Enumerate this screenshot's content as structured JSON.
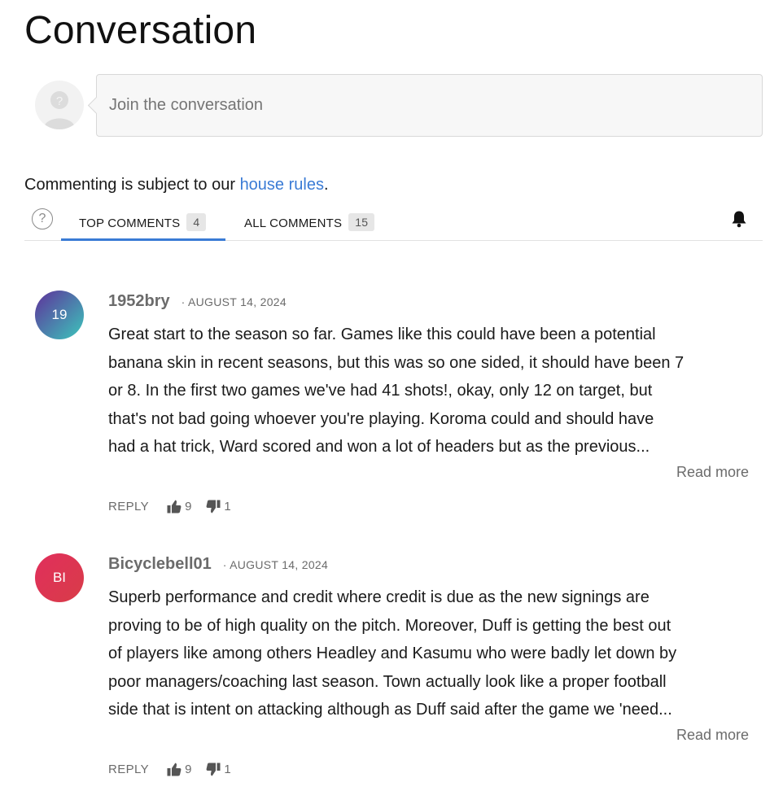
{
  "page": {
    "title": "Conversation"
  },
  "composer": {
    "placeholder": "Join the conversation"
  },
  "rules": {
    "prefix": "Commenting is subject to our ",
    "link": "house rules",
    "suffix": "."
  },
  "tabs": [
    {
      "label": "TOP COMMENTS",
      "count": "4",
      "active": true
    },
    {
      "label": "ALL COMMENTS",
      "count": "15",
      "active": false
    }
  ],
  "icons": {
    "help": "?",
    "bell": "bell-icon",
    "thumb_up": "thumbs-up-icon",
    "thumb_down": "thumbs-down-icon"
  },
  "colors": {
    "accent": "#3a7bd5",
    "avatar1_from": "#5b3f9e",
    "avatar1_to": "#3fb8b8",
    "avatar2_from": "#e0305a",
    "avatar2_to": "#d93b4a"
  },
  "comments": [
    {
      "avatar_text": "19",
      "username": "1952bry",
      "date": "· AUGUST 14, 2024",
      "lines": [
        "Great start to the season so far. Games like this could have been a potential",
        "banana skin in recent seasons, but this was so one sided, it should have been 7",
        "or 8. In the first two games we've had 41 shots!, okay, only 12 on target, but",
        "that's not bad going whoever you're playing. Koroma could and should have",
        "had a hat trick, Ward scored and won a lot of headers but as the previous..."
      ],
      "read_more": "Read more",
      "reply": "REPLY",
      "upvotes": "9",
      "downvotes": "1"
    },
    {
      "avatar_text": "BI",
      "username": "Bicyclebell01",
      "date": "· AUGUST 14, 2024",
      "lines": [
        "Superb performance and credit where credit is due as the new signings are",
        "proving to be of high quality on the pitch. Moreover, Duff is getting the best out",
        "of players like among others Headley and Kasumu who were badly let down by",
        "poor managers/coaching last season. Town actually look like a proper football",
        "side that is intent on attacking although as Duff said after the game we 'need..."
      ],
      "read_more": "Read more",
      "reply": "REPLY",
      "upvotes": "9",
      "downvotes": "1"
    }
  ]
}
